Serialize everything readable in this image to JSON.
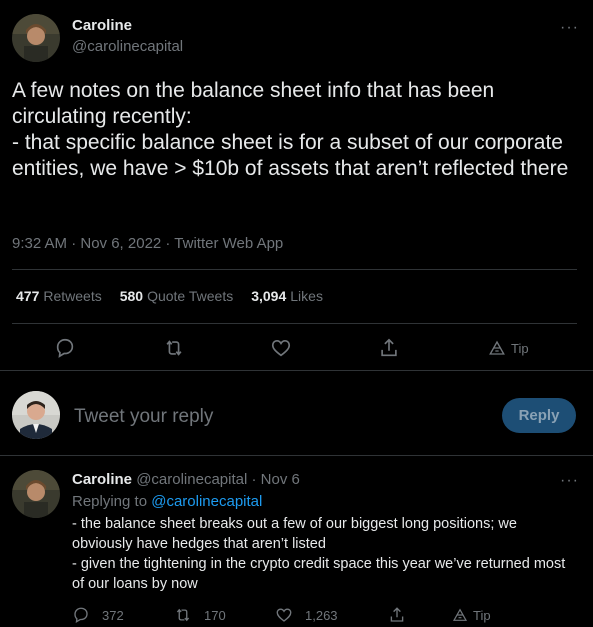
{
  "tweet": {
    "author_name": "Caroline",
    "author_handle": "@carolinecapital",
    "more_label": "···",
    "text": "A few notes on the balance sheet info that has been circulating recently:\n- that specific balance sheet is for a subset of our corporate entities, we have > $10b of assets that aren’t reflected there",
    "meta": "9:32 AM · Nov 6, 2022 · Twitter Web App",
    "stats": {
      "retweets_count": "477",
      "retweets_label": "Retweets",
      "quotes_count": "580",
      "quotes_label": "Quote Tweets",
      "likes_count": "3,094",
      "likes_label": "Likes"
    },
    "actions": {
      "tip_label": "Tip"
    }
  },
  "reply_box": {
    "placeholder": "Tweet your reply",
    "button_label": "Reply"
  },
  "reply_tweet": {
    "author_name": "Caroline",
    "author_handle": "@carolinecapital",
    "date": "· Nov 6",
    "more_label": "···",
    "replying_prefix": "Replying to ",
    "replying_to": "@carolinecapital",
    "text": "- the balance sheet breaks out a few of our biggest long positions; we obviously have hedges that aren’t listed\n- given the tightening in the crypto credit space this year we’ve returned most of our loans by now",
    "reply_count": "372",
    "retweet_count": "170",
    "like_count": "1,263",
    "tip_label": "Tip"
  },
  "colors": {
    "background": "#000000",
    "text": "#e7e9ea",
    "muted": "#71767b",
    "link": "#1d9bf0",
    "button_bg": "#1d4e75",
    "divider": "#2f3336"
  }
}
